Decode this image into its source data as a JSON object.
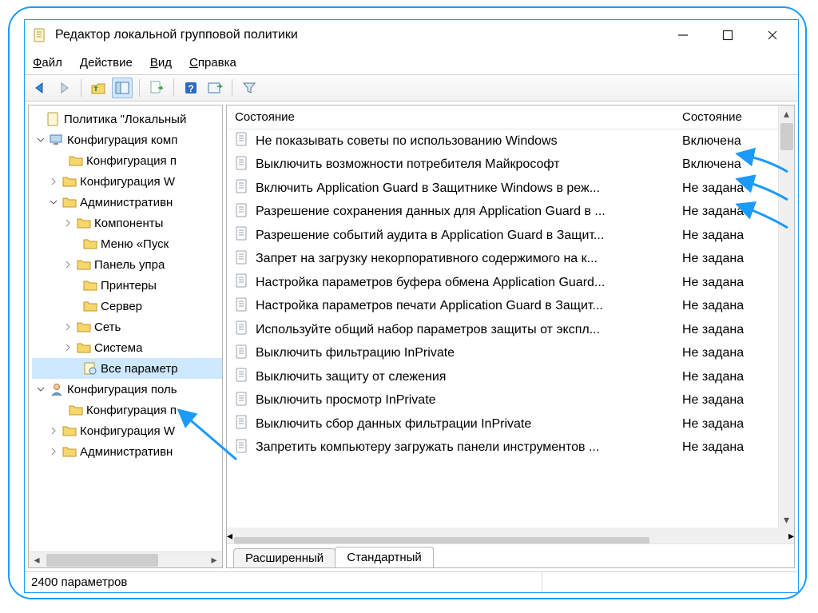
{
  "title": "Редактор локальной групповой политики",
  "menu": {
    "file": "Файл",
    "action": "Действие",
    "view": "Вид",
    "help": "Справка"
  },
  "tree": {
    "root": "Политика \"Локальный",
    "comp": "Конфигурация комп",
    "confP": "Конфигурация п",
    "confW": "Конфигурация W",
    "admin": "Административн",
    "components": "Компоненты",
    "startMenu": "Меню «Пуск",
    "controlPanel": "Панель упра",
    "printers": "Принтеры",
    "server": "Сервер",
    "network": "Сеть",
    "system": "Система",
    "allParams": "Все параметр",
    "user": "Конфигурация поль",
    "userConfP": "Конфигурация п",
    "userConfW": "Конфигурация W",
    "userAdmin": "Административн"
  },
  "columns": {
    "c1": "Состояние",
    "c2": "Состояние"
  },
  "rows": [
    {
      "name": "Не показывать советы по использованию Windows",
      "state": "Включена"
    },
    {
      "name": "Выключить возможности потребителя Майкрософт",
      "state": "Включена"
    },
    {
      "name": "Включить Application Guard в Защитнике Windows в реж...",
      "state": "Не задана"
    },
    {
      "name": "Разрешение сохранения данных для Application Guard в ...",
      "state": "Не задана"
    },
    {
      "name": "Разрешение событий аудита в Application Guard в Защит...",
      "state": "Не задана"
    },
    {
      "name": "Запрет на загрузку некорпоративного содержимого на к...",
      "state": "Не задана"
    },
    {
      "name": "Настройка параметров буфера обмена Application Guard...",
      "state": "Не задана"
    },
    {
      "name": "Настройка параметров печати Application Guard в Защит...",
      "state": "Не задана"
    },
    {
      "name": "Используйте общий набор параметров защиты от экспл...",
      "state": "Не задана"
    },
    {
      "name": "Выключить фильтрацию InPrivate",
      "state": "Не задана"
    },
    {
      "name": "Выключить защиту от слежения",
      "state": "Не задана"
    },
    {
      "name": "Выключить просмотр InPrivate",
      "state": "Не задана"
    },
    {
      "name": "Выключить сбор данных фильтрации InPrivate",
      "state": "Не задана"
    },
    {
      "name": "Запретить компьютеру загружать панели инструментов ...",
      "state": "Не задана"
    }
  ],
  "tabs": {
    "extended": "Расширенный",
    "standard": "Стандартный"
  },
  "status": "2400 параметров"
}
